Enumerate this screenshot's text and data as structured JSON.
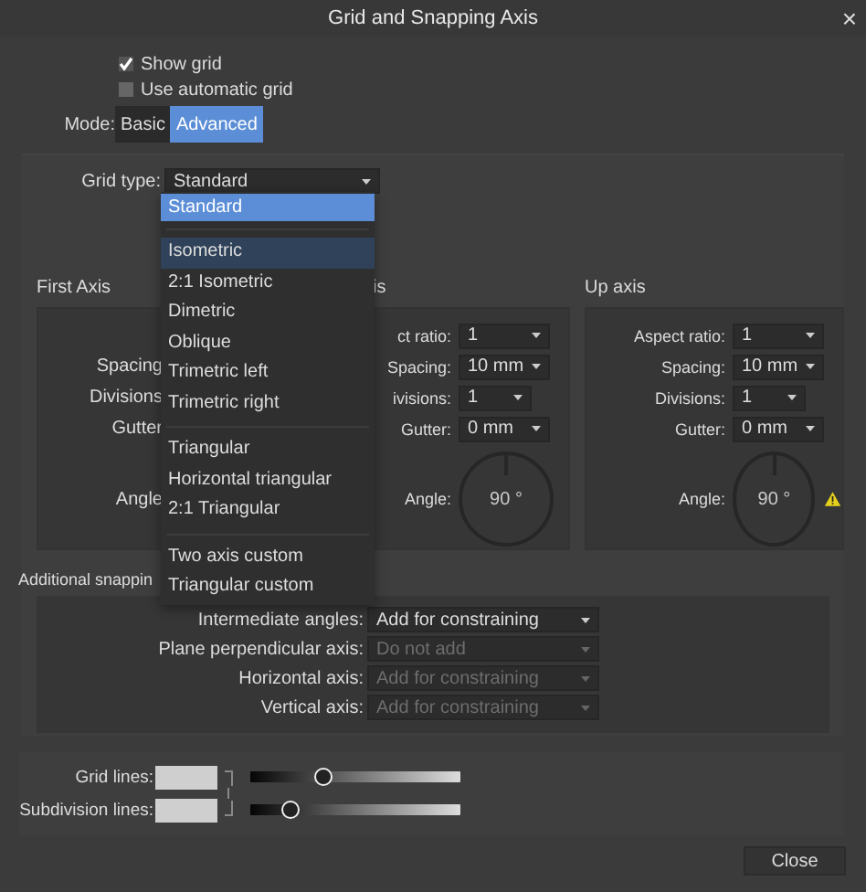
{
  "window": {
    "title": "Grid and Snapping Axis",
    "close": "×"
  },
  "show_grid": {
    "label": "Show grid",
    "checked": true
  },
  "automatic_grid": {
    "label": "Use automatic grid",
    "checked": false
  },
  "mode": {
    "label": "Mode:",
    "options": [
      {
        "label": "Basic",
        "selected": false
      },
      {
        "label": "Advanced",
        "selected": true
      }
    ]
  },
  "grid_type": {
    "label": "Grid type:",
    "value": "Standard",
    "menu_groups": [
      [
        {
          "label": "Standard",
          "selected": true,
          "hovered": false
        }
      ],
      [
        {
          "label": "Isometric",
          "selected": false,
          "hovered": true
        },
        {
          "label": "2:1 Isometric",
          "selected": false,
          "hovered": false
        },
        {
          "label": "Dimetric",
          "selected": false,
          "hovered": false
        },
        {
          "label": "Oblique",
          "selected": false,
          "hovered": false
        },
        {
          "label": "Trimetric left",
          "selected": false,
          "hovered": false
        },
        {
          "label": "Trimetric right",
          "selected": false,
          "hovered": false
        }
      ],
      [
        {
          "label": "Triangular",
          "selected": false,
          "hovered": false
        },
        {
          "label": "Horizontal triangular",
          "selected": false,
          "hovered": false
        },
        {
          "label": "2:1 Triangular",
          "selected": false,
          "hovered": false
        }
      ],
      [
        {
          "label": "Two axis custom",
          "selected": false,
          "hovered": false
        },
        {
          "label": "Triangular custom",
          "selected": false,
          "hovered": false
        }
      ]
    ]
  },
  "axes": [
    {
      "title": "First Axis",
      "fields": [
        {
          "label": "Spacing"
        },
        {
          "label": "Divisions"
        },
        {
          "label": "Gutter"
        }
      ],
      "angle": {
        "label": "Angle"
      }
    },
    {
      "title": "is",
      "fields": [
        {
          "label": "ct ratio:",
          "value": "1"
        },
        {
          "label": "Spacing:",
          "value": "10 mm"
        },
        {
          "label": "ivisions:",
          "value": "1"
        },
        {
          "label": "Gutter:",
          "value": "0 mm"
        }
      ],
      "angle": {
        "label": "Angle:",
        "value": "90 °"
      }
    },
    {
      "title": "Up axis",
      "fields": [
        {
          "label": "Aspect ratio:",
          "value": "1"
        },
        {
          "label": "Spacing:",
          "value": "10 mm"
        },
        {
          "label": "Divisions:",
          "value": "1"
        },
        {
          "label": "Gutter:",
          "value": "0 mm"
        }
      ],
      "angle": {
        "label": "Angle:",
        "value": "90 °"
      },
      "warning": true
    }
  ],
  "additional_snapping": {
    "title": "Additional snappin",
    "rows": [
      {
        "label": "Intermediate angles:",
        "value": "Add for constraining",
        "disabled": false
      },
      {
        "label": "Plane perpendicular axis:",
        "value": "Do not add",
        "disabled": true
      },
      {
        "label": "Horizontal axis:",
        "value": "Add for constraining",
        "disabled": true
      },
      {
        "label": "Vertical axis:",
        "value": "Add for constraining",
        "disabled": true
      }
    ]
  },
  "lines": [
    {
      "label": "Grid lines:",
      "level": 0.35
    },
    {
      "label": "Subdivision lines:",
      "level": 0.19
    }
  ],
  "close_button": "Close"
}
